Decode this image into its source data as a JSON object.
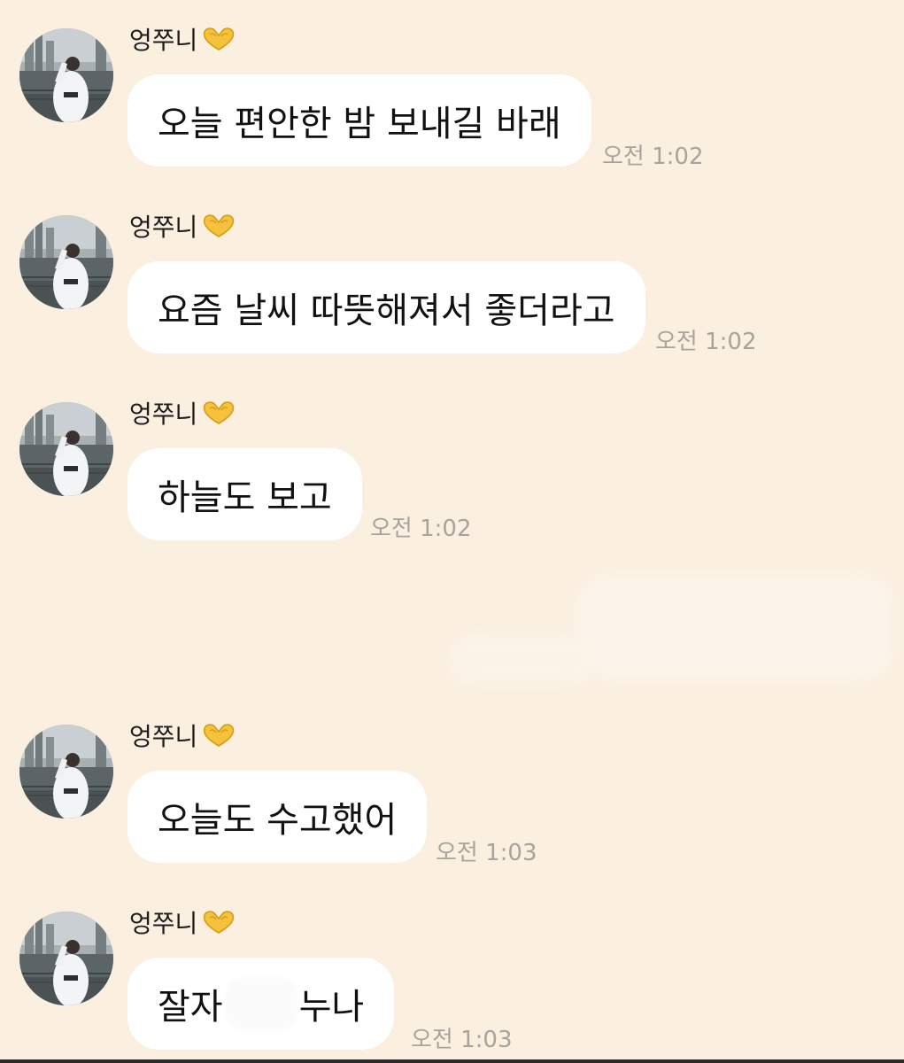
{
  "chat": {
    "messages": [
      {
        "sender": "엉쭈니",
        "text": "오늘 편안한 밤 보내길 바래",
        "time": "오전 1:02"
      },
      {
        "sender": "엉쭈니",
        "text": "요즘 날씨 따뜻해져서 좋더라고",
        "time": "오전 1:02"
      },
      {
        "sender": "엉쭈니",
        "text": "하늘도 보고",
        "time": "오전 1:02"
      },
      {
        "sender": "엉쭈니",
        "text": "오늘도 수고했어",
        "time": "오전 1:03"
      },
      {
        "sender": "엉쭈니",
        "text_before": "잘자",
        "text_after": "누나",
        "time": "오전 1:03"
      }
    ]
  },
  "icons": {
    "sender_emoji": "heart-hands-icon"
  },
  "colors": {
    "background": "#fbefdf",
    "bubble": "#ffffff",
    "timestamp": "#a7a39d",
    "heart": "#f5c23e"
  }
}
